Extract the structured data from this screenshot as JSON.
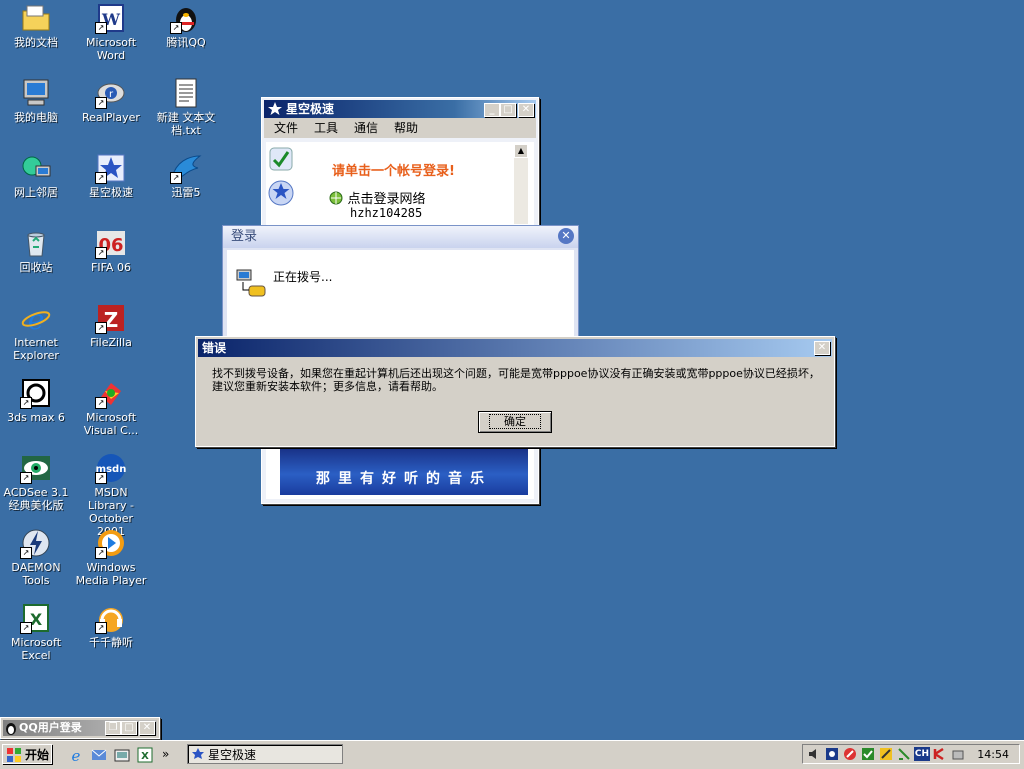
{
  "desktop": {
    "icons": [
      {
        "label": "我的文档"
      },
      {
        "label": "Microsoft\nWord"
      },
      {
        "label": "腾讯QQ"
      },
      {
        "label": "我的电脑"
      },
      {
        "label": "RealPlayer"
      },
      {
        "label": "新建 文本文\n档.txt"
      },
      {
        "label": "网上邻居"
      },
      {
        "label": "星空极速"
      },
      {
        "label": "迅雷5"
      },
      {
        "label": "回收站"
      },
      {
        "label": "FIFA 06"
      },
      {
        "label": "Internet\nExplorer"
      },
      {
        "label": "FileZilla"
      },
      {
        "label": "3ds max 6"
      },
      {
        "label": "Microsoft\nVisual C..."
      },
      {
        "label": "ACDSee 3.1\n经典美化版"
      },
      {
        "label": "MSDN Library -\nOctober 2001"
      },
      {
        "label": "DAEMON Tools"
      },
      {
        "label": "Windows\nMedia Player"
      },
      {
        "label": "Microsoft\nExcel"
      },
      {
        "label": "千千静听"
      }
    ]
  },
  "xk_window": {
    "title": "星空极速",
    "menu": [
      "文件",
      "工具",
      "通信",
      "帮助"
    ],
    "prompt": "请单击一个帐号登录!",
    "login_link": "点击登录网络",
    "account": "hzhz104285",
    "banner": "那里有好听的音乐"
  },
  "login_dialog": {
    "title": "登录",
    "status": "正在拨号..."
  },
  "error_dialog": {
    "title": "错误",
    "message": "找不到拨号设备，如果您在重起计算机后还出现这个问题，可能是宽带pppoe协议没有正确安装或宽带pppoe协议已经损坏，建议您重新安装本软件；更多信息，请看帮助。",
    "ok": "确定"
  },
  "qq_bar": {
    "title": "QQ用户登录"
  },
  "taskbar": {
    "start": "开始",
    "task": "星空极速",
    "clock": "14:54",
    "tray_lang": "CH"
  },
  "colors": {
    "desktop": "#3a6ea5",
    "accent": "#0a246a",
    "prompt": "#e8601c"
  }
}
